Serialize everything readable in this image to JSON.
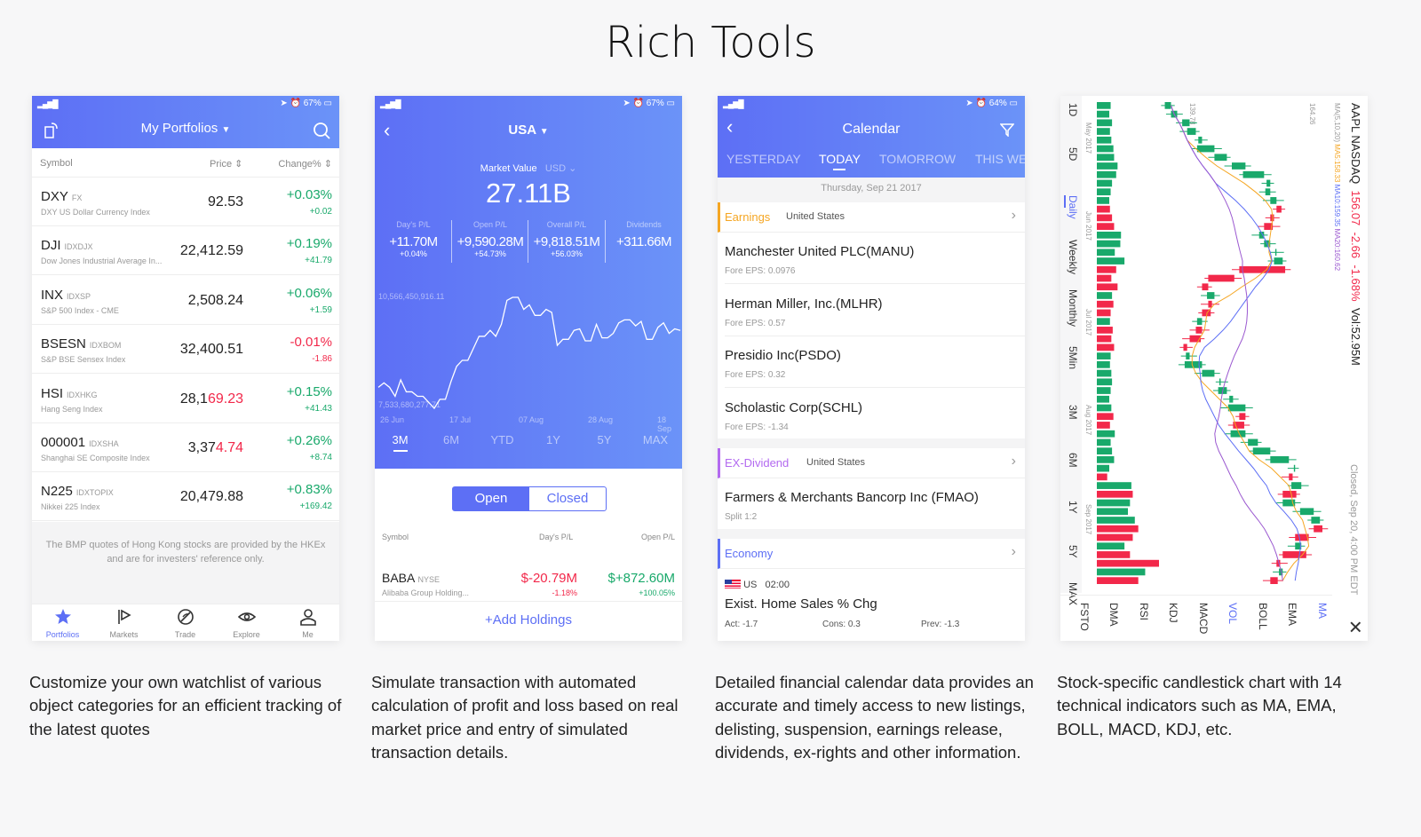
{
  "title": "Rich Tools",
  "colors": {
    "accent": "#5d6ff5",
    "up": "#19a96b",
    "down": "#f2284a"
  },
  "portfolio": {
    "status": {
      "battery": "67%"
    },
    "header": "My Portfolios",
    "columns": [
      "Symbol",
      "Price",
      "Change%"
    ],
    "rows": [
      {
        "sym": "DXY",
        "ex": "FX",
        "desc": "DXY US Dollar Currency Index",
        "price_a": "92.53",
        "price_b": "",
        "pct": "+0.03%",
        "chg": "+0.02",
        "dir": "up"
      },
      {
        "sym": "DJI",
        "ex": "IDXDJX",
        "desc": "Dow Jones Industrial Average In...",
        "price_a": "22,412.59",
        "price_b": "",
        "pct": "+0.19%",
        "chg": "+41.79",
        "dir": "up"
      },
      {
        "sym": "INX",
        "ex": "IDXSP",
        "desc": "S&P 500 Index - CME",
        "price_a": "2,508.24",
        "price_b": "",
        "pct": "+0.06%",
        "chg": "+1.59",
        "dir": "up"
      },
      {
        "sym": "BSESN",
        "ex": "IDXBOM",
        "desc": "S&P BSE Sensex Index",
        "price_a": "32,400.51",
        "price_b": "",
        "pct": "-0.01%",
        "chg": "-1.86",
        "dir": "down"
      },
      {
        "sym": "HSI",
        "ex": "IDXHKG",
        "desc": "Hang Seng Index",
        "price_a": "28,1",
        "price_b": "69.23",
        "pct": "+0.15%",
        "chg": "+41.43",
        "dir": "up"
      },
      {
        "sym": "000001",
        "ex": "IDXSHA",
        "desc": "Shanghai SE Composite Index",
        "price_a": "3,37",
        "price_b": "4.74",
        "pct": "+0.26%",
        "chg": "+8.74",
        "dir": "up"
      },
      {
        "sym": "N225",
        "ex": "IDXTOPIX",
        "desc": "Nikkei 225 Index",
        "price_a": "20,479.88",
        "price_b": "",
        "pct": "+0.83%",
        "chg": "+169.42",
        "dir": "up"
      }
    ],
    "note": "The BMP quotes of Hong Kong stocks are provided by the HKEx and are for investers' reference only.",
    "tabs": [
      {
        "label": "Portfolios",
        "icon": "star-icon"
      },
      {
        "label": "Markets",
        "icon": "flag-icon"
      },
      {
        "label": "Trade",
        "icon": "trade-icon"
      },
      {
        "label": "Explore",
        "icon": "eye-icon"
      },
      {
        "label": "Me",
        "icon": "user-icon"
      }
    ],
    "caption": "Customize your own watchlist of various object categories for an efficient tracking of the latest quotes"
  },
  "trade": {
    "status": {
      "battery": "67%"
    },
    "header": "USA",
    "mv_label": "Market Value",
    "currency": "USD",
    "mv": "27.11B",
    "stats": [
      {
        "label": "Day's P/L",
        "value": "+11.70M",
        "pct": "+0.04%"
      },
      {
        "label": "Open P/L",
        "value": "+9,590.28M",
        "pct": "+54.73%"
      },
      {
        "label": "Overall P/L",
        "value": "+9,818.51M",
        "pct": "+56.03%"
      },
      {
        "label": "Dividends",
        "value": "+311.66M",
        "pct": ""
      }
    ],
    "chart_max_label": "10,566,450,916.11",
    "chart_min_label": "7,533,680,277.71",
    "dates": [
      "26 Jun",
      "17 Jul",
      "07 Aug",
      "28 Aug",
      "18 Sep"
    ],
    "ranges": [
      "3M",
      "6M",
      "YTD",
      "1Y",
      "5Y",
      "MAX"
    ],
    "seg": [
      "Open",
      "Closed"
    ],
    "cols": [
      "Symbol",
      "Day's P/L",
      "Open P/L"
    ],
    "holding": {
      "sym": "BABA",
      "ex": "NYSE",
      "desc": "Alibaba Group Holding...",
      "day": "$-20.79M",
      "day_pct": "-1.18%",
      "open": "$+872.60M",
      "open_pct": "+100.05%"
    },
    "add": "+Add Holdings",
    "caption": "Simulate transaction with automated calculation of profit and loss based on real market price and entry of simulated transaction details."
  },
  "calendar": {
    "status": {
      "battery": "64%"
    },
    "header": "Calendar",
    "tabs": [
      "YESTERDAY",
      "TODAY",
      "TOMORROW",
      "THIS WEEK"
    ],
    "date": "Thursday, Sep 21 2017",
    "earnings": {
      "label": "Earnings",
      "region": "United States",
      "items": [
        {
          "name": "Manchester United PLC(MANU)",
          "sub": "Fore EPS: 0.0976"
        },
        {
          "name": "Herman Miller, Inc.(MLHR)",
          "sub": "Fore EPS: 0.57"
        },
        {
          "name": "Presidio Inc(PSDO)",
          "sub": "Fore EPS: 0.32"
        },
        {
          "name": "Scholastic Corp(SCHL)",
          "sub": "Fore EPS: -1.34"
        }
      ]
    },
    "dividend": {
      "label": "EX-Dividend",
      "region": "United States",
      "items": [
        {
          "name": "Farmers & Merchants Bancorp Inc (FMAO)",
          "sub": "Split 1:2"
        }
      ]
    },
    "economy": {
      "label": "Economy",
      "country": "US",
      "time": "02:00",
      "name": "Exist. Home Sales % Chg",
      "act": "Act: -1.7",
      "cons": "Cons: 0.3",
      "prev": "Prev: -1.3"
    },
    "caption": "Detailed financial calendar data provides an accurate and timely access to new listings, delisting, suspension, earnings release, dividends, ex-rights and other information."
  },
  "kline": {
    "title": "AAPL NASDAQ",
    "price": "156.07",
    "chg": "-2.66",
    "pct": "-1.68%",
    "vol": "Vol:52.95M",
    "closed": "Closed, Sep 20, 4:00 PM EDT",
    "ma_label": "MA(5,10,20)",
    "ma5": "MA5:158.33",
    "ma10": "MA10:159.35",
    "ma20": "MA20:160.62",
    "hi": "164.26",
    "lo": "139.78",
    "months": [
      "May 2017",
      "Jun 2017",
      "Jul 2017",
      "Aug 2017",
      "Sep 2017"
    ],
    "periods": [
      "1D",
      "5D",
      "Daily",
      "Weekly",
      "Monthly",
      "5Min",
      "3M",
      "6M",
      "1Y",
      "5Y",
      "MAX"
    ],
    "active_period": "Daily",
    "indicators": [
      "MA",
      "EMA",
      "BOLL",
      "VOL",
      "MACD",
      "KDJ",
      "RSI",
      "DMA",
      "FSTO"
    ],
    "active_indicators": [
      "MA",
      "VOL"
    ],
    "caption": "Stock-specific candlestick chart with 14 technical indicators such as MA, EMA, BOLL, MACD, KDJ, etc."
  },
  "chart_data": [
    {
      "type": "line",
      "title": "",
      "ylim": [
        7533680277.71,
        10566450916.11
      ],
      "x_ticks": [
        "26 Jun",
        "17 Jul",
        "07 Aug",
        "28 Aug",
        "18 Sep"
      ],
      "values_billions": [
        8.107,
        8.229,
        8.107,
        7.861,
        8.311,
        7.984,
        7.984,
        7.861,
        7.861,
        7.697,
        7.533,
        7.779,
        7.779,
        8.27,
        8.68,
        8.844,
        8.844,
        9.172,
        9.5,
        9.5,
        9.664,
        9.5,
        9.828,
        10.484,
        10.566,
        10.566,
        10.238,
        10.361,
        10.074,
        10.074,
        10.238,
        10.156,
        9.254,
        9.418,
        9.418,
        9.664,
        9.705,
        9.377,
        9.377,
        9.828,
        9.459,
        9.459,
        9.582,
        9.869,
        9.951,
        9.951,
        9.787,
        9.91,
        9.418,
        9.418,
        9.746,
        9.869,
        9.582,
        9.705,
        9.664
      ]
    },
    {
      "type": "candlestick",
      "title": "AAPL NASDAQ",
      "ylim": [
        139.78,
        164.26
      ],
      "x_ticks": [
        "May 2017",
        "Jun 2017",
        "Jul 2017",
        "Aug 2017",
        "Sep 2017"
      ],
      "close": [
        140,
        141,
        143,
        144,
        145,
        147,
        149,
        152,
        155,
        156,
        156,
        157,
        157,
        156,
        155,
        155,
        156,
        157,
        158,
        151,
        146,
        145,
        147,
        146,
        145,
        145,
        144,
        143,
        142,
        143,
        145,
        147,
        148,
        149,
        150,
        152,
        151,
        150,
        152,
        154,
        156,
        159,
        160,
        159,
        161,
        158,
        160,
        163,
        164,
        163,
        160,
        161,
        158,
        157,
        158,
        156
      ],
      "volume": [
        20,
        18,
        22,
        19,
        21,
        24,
        25,
        30,
        28,
        22,
        20,
        18,
        19,
        22,
        25,
        35,
        34,
        26,
        40,
        28,
        21,
        30,
        22,
        24,
        20,
        19,
        23,
        21,
        25,
        20,
        19,
        21,
        22,
        20,
        18,
        21,
        24,
        19,
        26,
        20,
        22,
        25,
        18,
        15,
        50,
        52,
        48,
        45,
        55,
        60,
        52,
        40,
        48,
        90,
        70,
        60
      ]
    }
  ]
}
